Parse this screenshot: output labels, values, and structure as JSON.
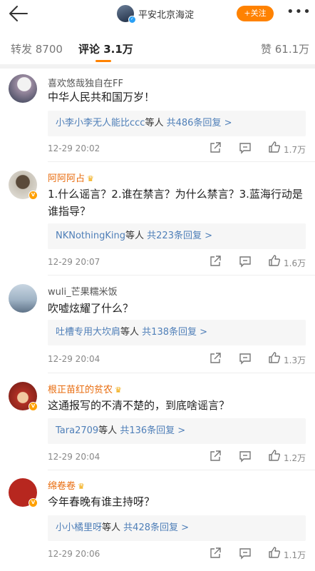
{
  "header": {
    "account_name": "平安北京海淀",
    "follow_label": "+关注",
    "more_label": "•••"
  },
  "tabs": {
    "repost": "转发 8700",
    "comments": "评论 3.1万",
    "likes": "赞 61.1万"
  },
  "colors": {
    "accent": "#ff8200",
    "link": "#4f7fb8",
    "vip_name": "#e86b0d"
  },
  "comments": [
    {
      "user": "喜欢悠哉独自在FF",
      "vip": false,
      "text": "中华人民共和国万岁！",
      "reply_who": "小李小李无人能比ccc",
      "reply_mid": "等人",
      "reply_count": "共486条回复",
      "chev": ">",
      "time": "12-29 20:02",
      "likes": "1.7万"
    },
    {
      "user": "阿阿阿占",
      "vip": true,
      "text": "1.什么谣言？2.谁在禁言？为什么禁言？3.蓝海行动是谁指导？",
      "reply_who": "NKNothingKing",
      "reply_mid": "等人",
      "reply_count": "共223条回复",
      "chev": ">",
      "time": "12-29 20:07",
      "likes": "1.6万"
    },
    {
      "user": "wuli_芒果糯米饭",
      "vip": false,
      "text": "吹嘘炫耀了什么？",
      "reply_who": "吐槽专用大坎肩",
      "reply_mid": "等人",
      "reply_count": "共138条回复",
      "chev": ">",
      "time": "12-29 20:04",
      "likes": "1.3万"
    },
    {
      "user": "根正苗红的贫农",
      "vip": true,
      "text": "这通报写的不清不楚的，到底啥谣言？",
      "reply_who": "Tara2709",
      "reply_mid": "等人",
      "reply_count": "共136条回复",
      "chev": ">",
      "time": "12-29 20:04",
      "likes": "1.2万"
    },
    {
      "user": "绵卷卷",
      "vip": true,
      "text": "今年春晚有谁主持呀？",
      "reply_who": "小小橘里呀",
      "reply_mid": "等人",
      "reply_count": "共428条回复",
      "chev": ">",
      "time": "12-29 20:06",
      "likes": "1.1万"
    }
  ]
}
